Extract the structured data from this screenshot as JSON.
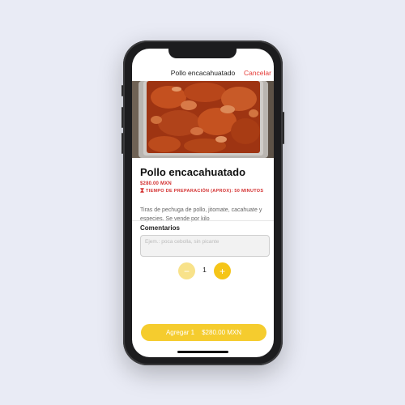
{
  "nav": {
    "title": "Pollo encacahuatado",
    "cancel_label": "Cancelar"
  },
  "product": {
    "name": "Pollo encacahuatado",
    "price": "$280.00 MXN",
    "prep_icon": "hourglass-icon",
    "prep_time": "TIEMPO DE PREPARACIÓN (APROX): 50 MINUTOS",
    "description": "Tiras de pechuga de pollo, jitomate, cacahuate y especies. Se vende por kilo"
  },
  "comments": {
    "label": "Comentarios",
    "placeholder": "Ejem.: poca cebolla, sin picante",
    "value": ""
  },
  "stepper": {
    "minus": "−",
    "quantity": "1",
    "plus": "+"
  },
  "add_button": {
    "label": "Agregar 1",
    "price": "$280.00 MXN"
  },
  "colors": {
    "accent": "#f5c518",
    "danger": "#e53935",
    "background": "#e9ebf5"
  }
}
